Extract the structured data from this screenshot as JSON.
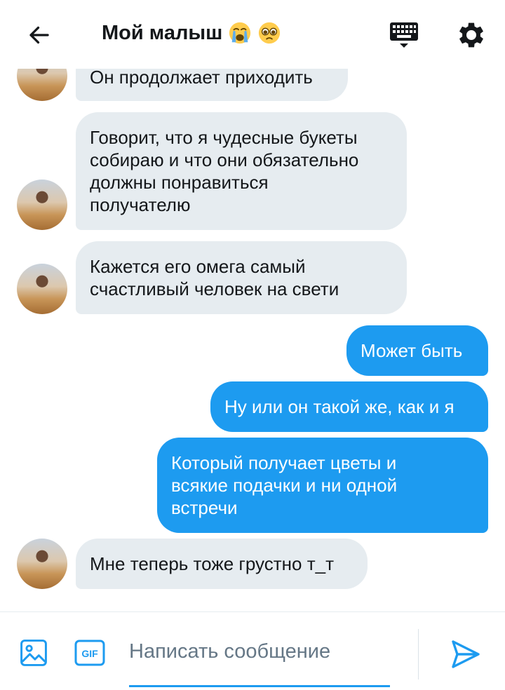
{
  "header": {
    "title": "Мой малыш",
    "icons": [
      "back-arrow-icon",
      "crying-face-emoji",
      "pleading-face-emoji",
      "keyboard-icon",
      "gear-icon"
    ]
  },
  "messages": [
    {
      "side": "in",
      "text": "Он продолжает приходить"
    },
    {
      "side": "in",
      "text": "Говорит, что я чудесные букеты\nсобираю и что они обязательно\nдолжны понравиться\nполучателю"
    },
    {
      "side": "in",
      "text": "Кажется его омега самый\nсчастливый человек на свети"
    },
    {
      "side": "out",
      "text": "Может быть"
    },
    {
      "side": "out",
      "text": "Ну или он такой же, как и я"
    },
    {
      "side": "out",
      "text": "Который получает цветы и\nвсякие подачки и ни одной\nвстречи"
    },
    {
      "side": "in",
      "text": "Мне теперь тоже грустно т_т"
    }
  ],
  "composer": {
    "placeholder": "Написать сообщение",
    "gif_label": "GIF"
  },
  "colors": {
    "accent": "#1d9bf0",
    "incoming_bubble": "#e6ecf0",
    "text": "#14171a",
    "placeholder": "#657786"
  }
}
